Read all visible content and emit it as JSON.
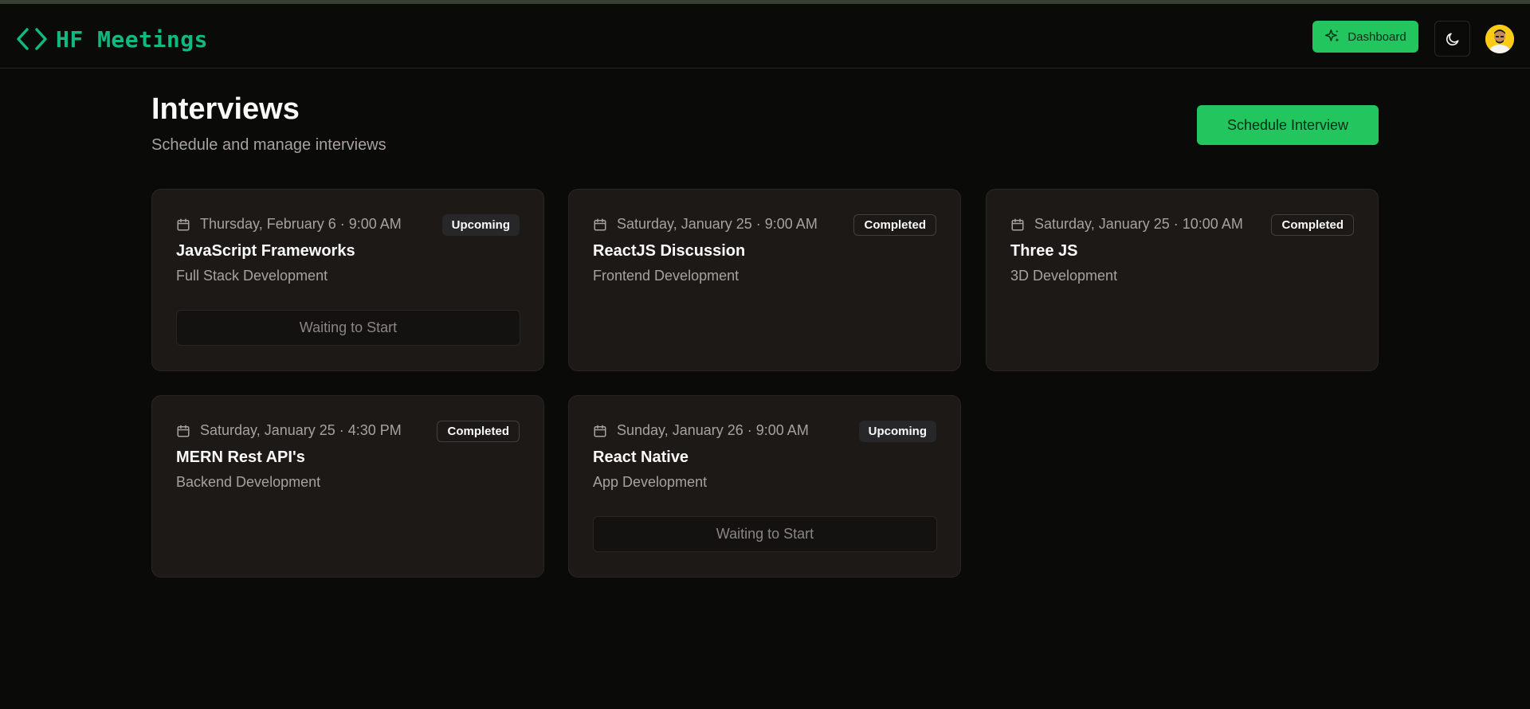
{
  "brand": {
    "name": "HF Meetings",
    "icon": "code-brackets-icon",
    "color": "#10b981"
  },
  "nav": {
    "dashboard_label": "Dashboard",
    "dashboard_icon": "sparkles-icon",
    "theme_icon": "moon-icon",
    "avatar": "user-avatar"
  },
  "page": {
    "title": "Interviews",
    "subtitle": "Schedule and manage interviews",
    "schedule_label": "Schedule Interview"
  },
  "colors": {
    "accent": "#22c55e",
    "background": "#0a0a09",
    "card": "#1c1917"
  },
  "interviews": [
    {
      "date": "Thursday, February 6 · 9:00 AM",
      "status": "Upcoming",
      "title": "JavaScript Frameworks",
      "description": "Full Stack Development",
      "action": "Waiting to Start"
    },
    {
      "date": "Saturday, January 25 · 9:00 AM",
      "status": "Completed",
      "title": "ReactJS Discussion",
      "description": "Frontend Development"
    },
    {
      "date": "Saturday, January 25 · 10:00 AM",
      "status": "Completed",
      "title": "Three JS",
      "description": "3D Development"
    },
    {
      "date": "Saturday, January 25 · 4:30 PM",
      "status": "Completed",
      "title": "MERN Rest API's",
      "description": "Backend Development"
    },
    {
      "date": "Sunday, January 26 · 9:00 AM",
      "status": "Upcoming",
      "title": "React Native",
      "description": "App Development",
      "action": "Waiting to Start"
    }
  ]
}
